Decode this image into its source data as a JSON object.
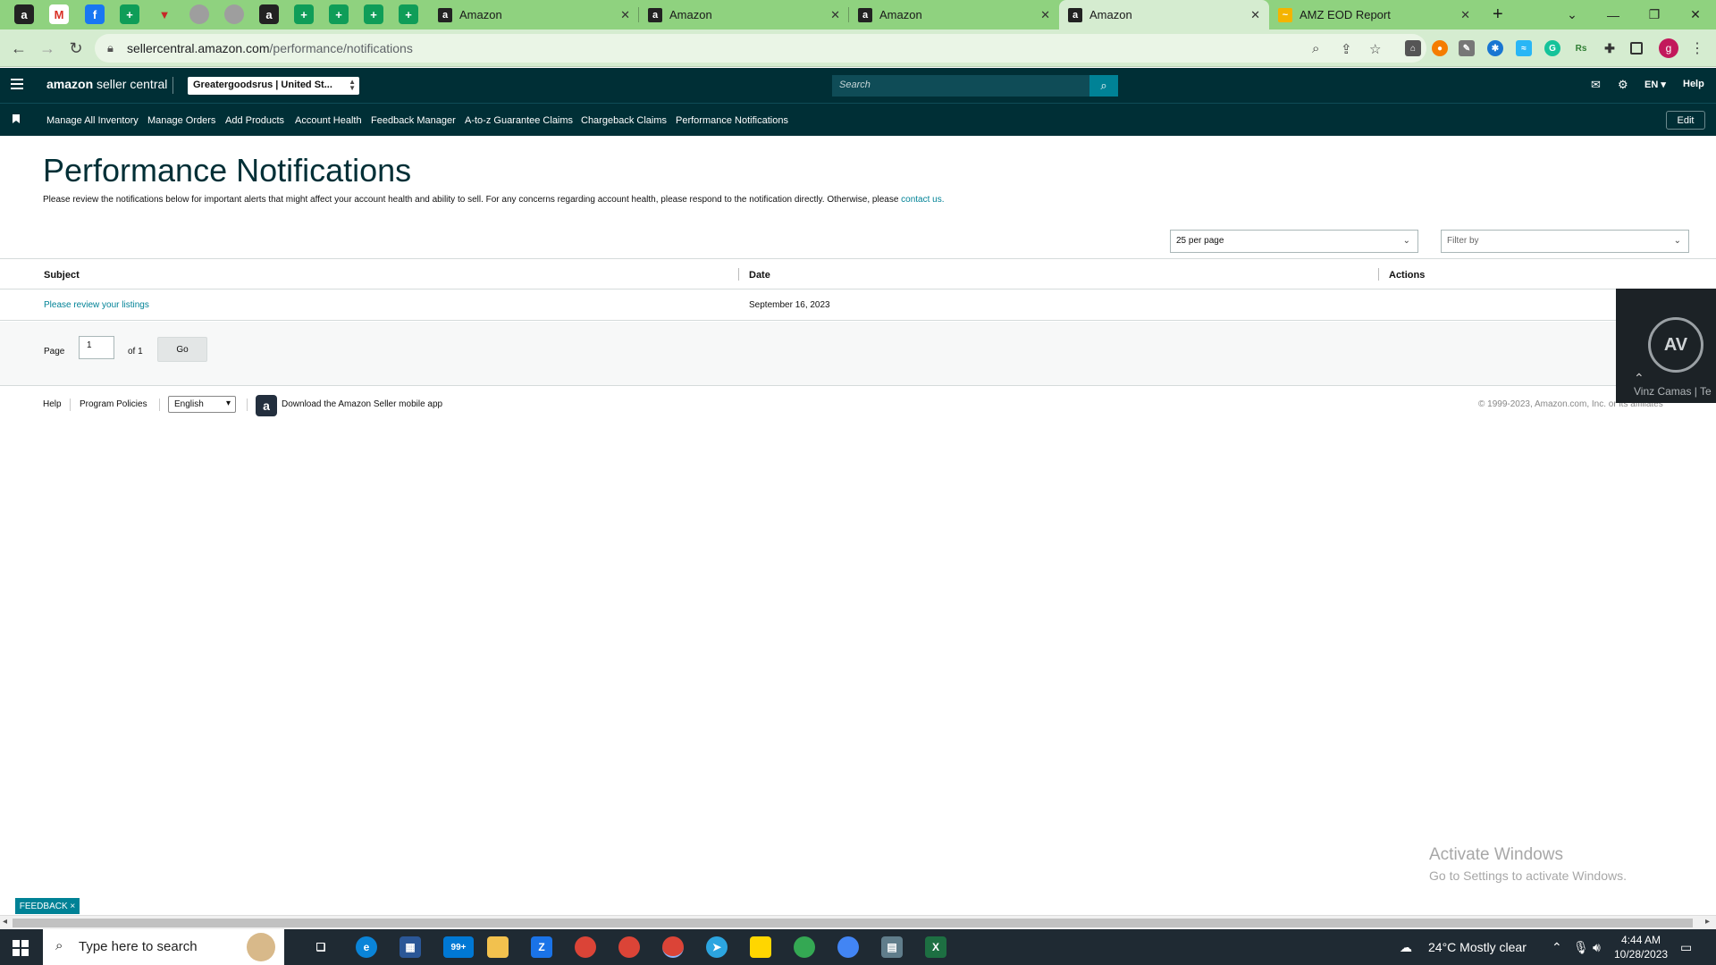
{
  "browser": {
    "tabs": [
      {
        "title": "Amazon"
      },
      {
        "title": "Amazon"
      },
      {
        "title": "Amazon"
      },
      {
        "title": "Amazon"
      },
      {
        "title": "AMZ EOD Report"
      }
    ],
    "active_tab_index": 3,
    "url_host": "sellercentral.amazon.com",
    "url_path": "/performance/notifications",
    "new_tab_symbol": "+"
  },
  "header": {
    "logo_prefix": "amazon",
    "logo_suffix": "seller central",
    "account_select_value": "Greatergoodsrus | United St...",
    "search_placeholder": "Search",
    "language": "EN",
    "help": "Help"
  },
  "nav": {
    "items": [
      "Manage All Inventory",
      "Manage Orders",
      "Add Products",
      "Account Health",
      "Feedback Manager",
      "A-to-z Guarantee Claims",
      "Chargeback Claims",
      "Performance Notifications"
    ],
    "edit_label": "Edit"
  },
  "page": {
    "title": "Performance Notifications",
    "intro": "Please review the notifications below for important alerts that might affect your account health and ability to sell. For any concerns regarding account health, please respond to the notification directly. Otherwise, please ",
    "intro_link": "contact us.",
    "per_page_value": "25 per page",
    "filter_placeholder": "Filter by"
  },
  "table": {
    "headers": [
      "Subject",
      "Date",
      "Actions"
    ],
    "rows": [
      {
        "subject": "Please review your listings",
        "date": "September 16, 2023",
        "actions": ""
      }
    ]
  },
  "pager": {
    "page_label": "Page",
    "current_page": "1",
    "of_label": "of 1",
    "go_label": "Go"
  },
  "footer": {
    "help": "Help",
    "program_policies": "Program Policies",
    "language_value": "English",
    "app_text": "Download the Amazon Seller mobile app",
    "copyright": "© 1999-2023, Amazon.com, Inc. or its affiliates"
  },
  "video_widget": {
    "caption": "Vinz Camas | Te"
  },
  "watermark": {
    "line1": "Activate Windows",
    "line2": "Go to Settings to activate Windows."
  },
  "feedback_label": "FEEDBACK ×",
  "taskbar": {
    "search_placeholder": "Type here to search",
    "mail_badge": "99+",
    "weather": "24°C  Mostly clear",
    "time": "4:44 AM",
    "date": "10/28/2023"
  },
  "colors": {
    "header_bg": "#002f36",
    "accent_teal": "#008296",
    "tabbar_bg": "#8fd27f",
    "title_color": "#002f36"
  }
}
